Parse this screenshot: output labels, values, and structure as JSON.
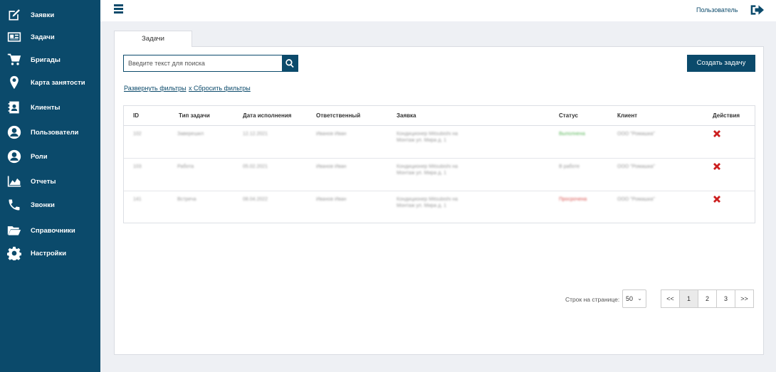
{
  "sidebar": {
    "items": [
      {
        "label": "Заявки",
        "icon": "edit-icon"
      },
      {
        "label": "Задачи",
        "icon": "newspaper-icon"
      },
      {
        "label": "Бригады",
        "icon": "cart-icon"
      },
      {
        "label": "Карта занятости",
        "icon": "map-marker-icon"
      },
      {
        "label": "Клиенты",
        "icon": "contact-book-icon"
      },
      {
        "label": "Пользователи",
        "icon": "user-circle-icon"
      },
      {
        "label": "Роли",
        "icon": "user-circle-icon"
      },
      {
        "label": "Отчеты",
        "icon": "area-chart-icon"
      },
      {
        "label": "Звонки",
        "icon": "phone-icon"
      },
      {
        "label": "Справочники",
        "icon": "folder-open-icon"
      },
      {
        "label": "Настройки",
        "icon": "gear-icon"
      }
    ]
  },
  "header": {
    "user_label": "Пользователь"
  },
  "tab": {
    "label": "Задачи"
  },
  "search": {
    "placeholder": "Введите текст для поиска"
  },
  "toolbar": {
    "create_label": "Создать задачу"
  },
  "filters": {
    "expand_label": "Развернуть фильтры",
    "reset_label": "x Сбросить фильтры"
  },
  "table": {
    "columns": [
      "ID",
      "Тип задачи",
      "Дата исполнения",
      "Ответственный",
      "Заявка",
      "Статус",
      "Клиент",
      "Действия"
    ],
    "rows": [
      {
        "id": "102",
        "type": "Заверешил",
        "date": "12.12.2021",
        "assignee": "Иванов Иван",
        "request_line1": "Кондиционер Mitsubishi на",
        "request_line2": "Монтаж ул. Мира д. 1",
        "status": "Выполнена",
        "client": "ООО \"Ромашка\""
      },
      {
        "id": "103",
        "type": "Работа",
        "date": "05.02.2021",
        "assignee": "Иванов Иван",
        "request_line1": "Кондиционер Mitsubishi на",
        "request_line2": "Монтаж ул. Мира д. 1",
        "status": "В работе",
        "client": "ООО \"Ромашка\""
      },
      {
        "id": "141",
        "type": "Встреча",
        "date": "08.04.2022",
        "assignee": "Иванов Иван",
        "request_line1": "Кондиционер Mitsubishi на",
        "request_line2": "Монтаж ул. Мира д. 1",
        "status": "Просрочена",
        "client": "ООО \"Ромашка\""
      }
    ]
  },
  "pagination": {
    "per_page_label": "Строк на странице:",
    "per_page_value": "50",
    "first": "<<",
    "pages": [
      "1",
      "2",
      "3"
    ],
    "last": ">>",
    "current": "1"
  },
  "colors": {
    "sidebar_bg": "#0b4a6b",
    "accent": "#0b4a6b",
    "delete": "#cc1f1f",
    "status_done": "#5bb75b",
    "status_overdue": "#d9534f"
  }
}
